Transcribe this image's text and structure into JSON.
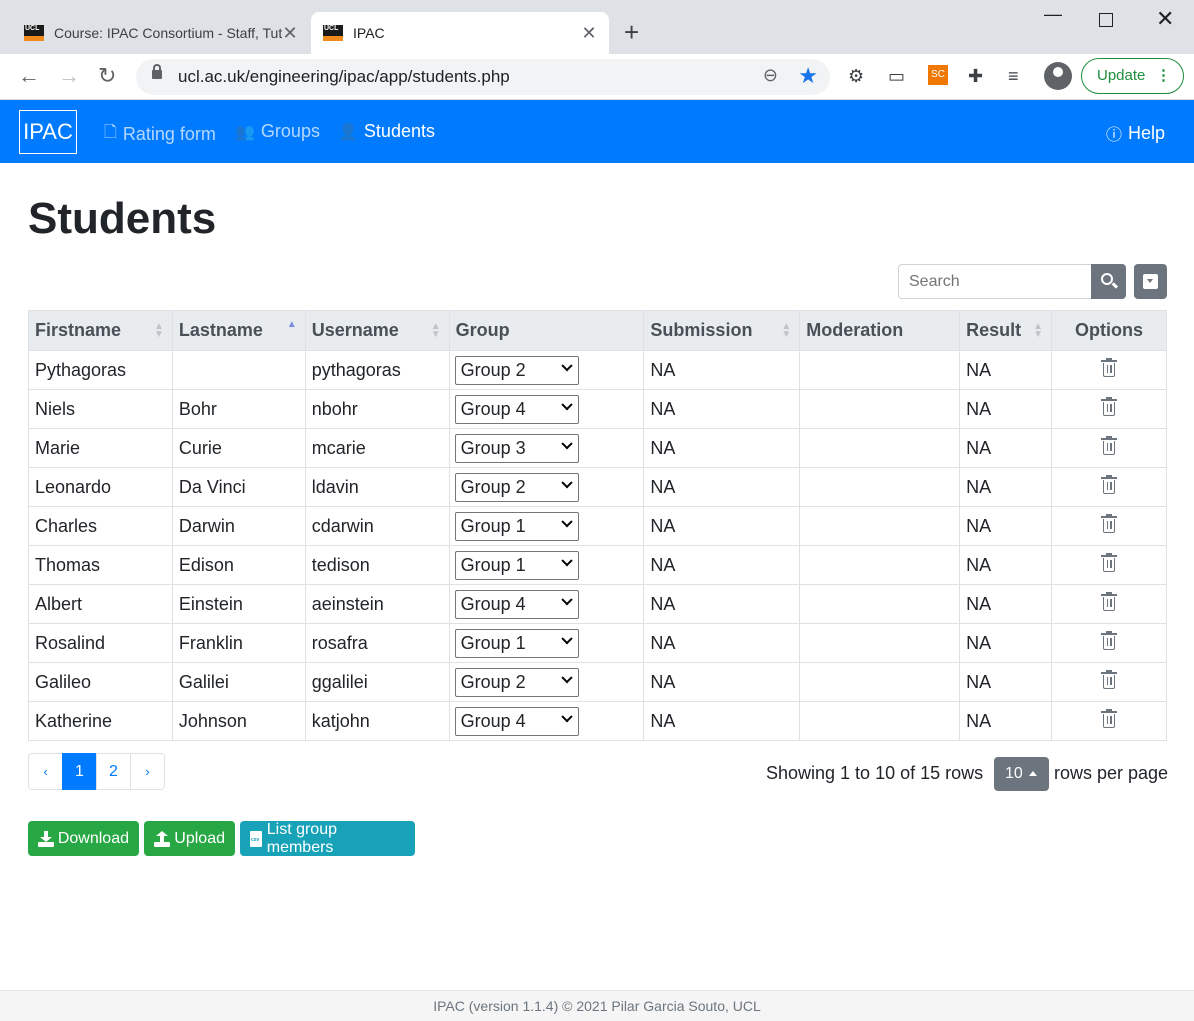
{
  "browser": {
    "tabs": [
      {
        "title": "Course: IPAC Consortium - Staff, Tutors",
        "close": "✕"
      },
      {
        "title": "IPAC",
        "close": "✕"
      }
    ],
    "new_tab": "+",
    "window_controls": {
      "minimize": "—",
      "close": "✕"
    },
    "url": "ucl.ac.uk/engineering/ipac/app/students.php",
    "update_label": "Update",
    "update_menu": "⋮",
    "icons": [
      "back-icon",
      "forward-icon",
      "reload-icon",
      "lock-icon",
      "zoom-icon",
      "star-icon",
      "extension-icon",
      "avatar-icon"
    ],
    "ext3_label": "SC"
  },
  "navbar": {
    "brand": "IPAC",
    "links": [
      {
        "label": "Rating form",
        "icon": "file-icon"
      },
      {
        "label": "Groups",
        "icon": "users-icon"
      },
      {
        "label": "Students",
        "icon": "user-icon"
      }
    ],
    "help": "Help",
    "color": "#007bff"
  },
  "page": {
    "title": "Students",
    "search_placeholder": "Search"
  },
  "table": {
    "headers": [
      "Firstname",
      "Lastname",
      "Username",
      "Group",
      "Submission",
      "Moderation",
      "Result",
      "Options"
    ],
    "rows": [
      {
        "first": "Pythagoras",
        "last": "",
        "user": "pythagoras",
        "group": "Group 2",
        "submission": "NA",
        "moderation": "",
        "result": "NA"
      },
      {
        "first": "Niels",
        "last": "Bohr",
        "user": "nbohr",
        "group": "Group 4",
        "submission": "NA",
        "moderation": "",
        "result": "NA"
      },
      {
        "first": "Marie",
        "last": "Curie",
        "user": "mcarie",
        "group": "Group 3",
        "submission": "NA",
        "moderation": "",
        "result": "NA"
      },
      {
        "first": "Leonardo",
        "last": "Da Vinci",
        "user": "ldavin",
        "group": "Group 2",
        "submission": "NA",
        "moderation": "",
        "result": "NA"
      },
      {
        "first": "Charles",
        "last": "Darwin",
        "user": "cdarwin",
        "group": "Group 1",
        "submission": "NA",
        "moderation": "",
        "result": "NA"
      },
      {
        "first": "Thomas",
        "last": "Edison",
        "user": "tedison",
        "group": "Group 1",
        "submission": "NA",
        "moderation": "",
        "result": "NA"
      },
      {
        "first": "Albert",
        "last": "Einstein",
        "user": "aeinstein",
        "group": "Group 4",
        "submission": "NA",
        "moderation": "",
        "result": "NA"
      },
      {
        "first": "Rosalind",
        "last": "Franklin",
        "user": "rosafra",
        "group": "Group 1",
        "submission": "NA",
        "moderation": "",
        "result": "NA"
      },
      {
        "first": "Galileo",
        "last": "Galilei",
        "user": "ggalilei",
        "group": "Group 2",
        "submission": "NA",
        "moderation": "",
        "result": "NA"
      },
      {
        "first": "Katherine",
        "last": "Johnson",
        "user": "katjohn",
        "group": "Group 4",
        "submission": "NA",
        "moderation": "",
        "result": "NA"
      }
    ]
  },
  "pagination": {
    "prev": "‹",
    "pages": [
      "1",
      "2"
    ],
    "active_page": "1",
    "next": "›",
    "info": "Showing 1 to 10 of 15 rows",
    "per_page": "10",
    "per_page_label": "rows per page"
  },
  "actions": {
    "download": "Download",
    "upload": "Upload",
    "list_members": "List group members"
  },
  "footer": {
    "text": "IPAC (version 1.1.4) © 2021 Pilar Garcia Souto, UCL"
  }
}
